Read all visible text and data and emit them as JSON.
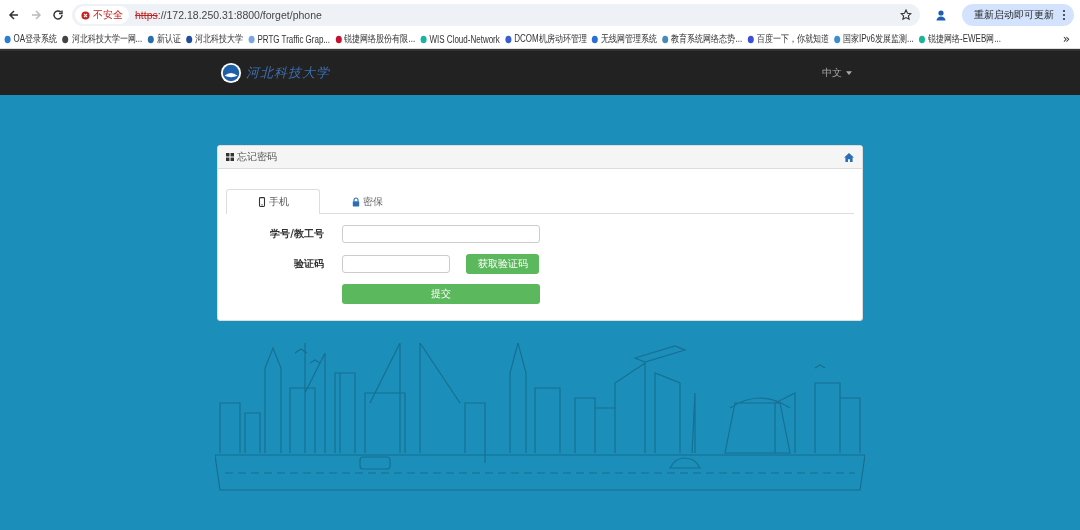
{
  "browser": {
    "back_enabled": true,
    "forward_enabled": false,
    "security_label": "不安全",
    "url_scheme": "https",
    "url_rest": "://172.18.250.31:8800/forget/phone",
    "update_button": "重新启动即可更新"
  },
  "bookmarks": [
    {
      "label": "OA登录系统",
      "color": "#2a7fd4"
    },
    {
      "label": "河北科技大学一网...",
      "color": "#444444"
    },
    {
      "label": "新认证",
      "color": "#2a6fa8"
    },
    {
      "label": "河北科技大学",
      "color": "#1f4f9a"
    },
    {
      "label": "PRTG Traffic Grap...",
      "color": "#7aa7e0"
    },
    {
      "label": "锐捷网络股份有限...",
      "color": "#c8102e"
    },
    {
      "label": "WIS Cloud-Network",
      "color": "#1bb3a8"
    },
    {
      "label": "DCOM机房动环管理",
      "color": "#3a5fcd"
    },
    {
      "label": "无线网管理系统",
      "color": "#2a6fd4"
    },
    {
      "label": "教育系统网络态势...",
      "color": "#4a8ab8"
    },
    {
      "label": "百度一下，你就知道",
      "color": "#3b4fd8"
    },
    {
      "label": "国家IPv6发展监测...",
      "color": "#3a8fd4"
    },
    {
      "label": "锐捷网络-EWEB网...",
      "color": "#1bb39a"
    }
  ],
  "bookmarks_more": "»",
  "navbar": {
    "logo_text": "河北科技大学",
    "language": "中文"
  },
  "panel": {
    "title": "忘记密码",
    "tabs": [
      {
        "kind": "phone",
        "label": "手机",
        "selected": true
      },
      {
        "kind": "lock",
        "label": "密保",
        "selected": false
      }
    ],
    "id_label": "学号/教工号",
    "code_label": "验证码",
    "code_button": "获取验证码",
    "submit": "提交"
  }
}
